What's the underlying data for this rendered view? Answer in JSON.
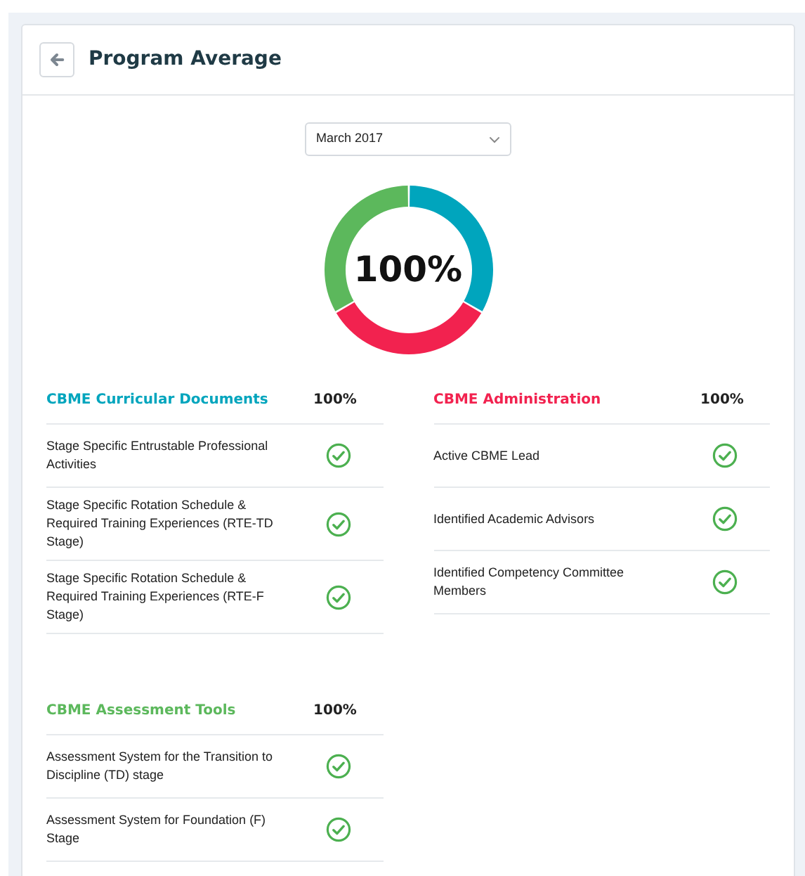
{
  "header": {
    "title": "Program Average"
  },
  "period_select": {
    "value": "March 2017"
  },
  "donut": {
    "label": "100%",
    "segments": [
      {
        "color": "#00a5bd"
      },
      {
        "color": "#f2224f"
      },
      {
        "color": "#5cb85c"
      }
    ]
  },
  "columns": [
    {
      "sections": [
        {
          "title": "CBME Curricular Documents",
          "color": "#00a5bd",
          "score": "100%",
          "items": [
            {
              "label": "Stage Specific Entrustable Professional Activities",
              "done": true
            },
            {
              "label": "Stage Specific Rotation Schedule & Required Training Experiences (RTE-TD Stage)",
              "done": true
            },
            {
              "label": "Stage Specific Rotation Schedule & Required Training Experiences (RTE-F Stage)",
              "done": true
            }
          ]
        },
        {
          "title": "CBME Assessment Tools",
          "color": "#5cb85c",
          "score": "100%",
          "items": [
            {
              "label": "Assessment System for the Transition to Discipline (TD) stage",
              "done": true
            },
            {
              "label": "Assessment System for Foundation (F) Stage",
              "done": true
            }
          ]
        }
      ]
    },
    {
      "sections": [
        {
          "title": "CBME Administration",
          "color": "#f2224f",
          "score": "100%",
          "items": [
            {
              "label": "Active CBME Lead",
              "done": true
            },
            {
              "label": "Identified Academic Advisors",
              "done": true
            },
            {
              "label": "Identified Competency Committee Members",
              "done": true
            }
          ]
        }
      ]
    }
  ]
}
